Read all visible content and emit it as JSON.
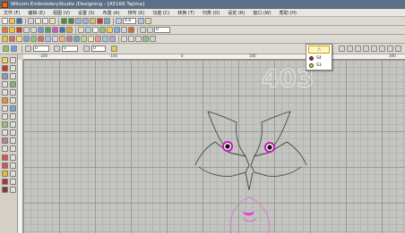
{
  "window": {
    "title": "Wilcom EmbroideryStudio /Designing - [A5166        Tajima]"
  },
  "menu": {
    "items": [
      "文件 (F)",
      "编辑 (E)",
      "视图 (V)",
      "设置 (S)",
      "布置 (A)",
      "排布 (K)",
      "功能 (C)",
      "转换 (T)",
      "归类 (O)",
      "设定 (R)",
      "窗口 (W)",
      "帮助 (H)"
    ]
  },
  "toolbar": {
    "zoom_value": "4.8",
    "combo_a": "0",
    "combo_b": "0",
    "combo_c": "0",
    "combo_d": "0"
  },
  "ruler": {
    "marks": [
      "-200",
      "-100",
      "0",
      "100",
      "200",
      "300"
    ]
  },
  "canvas": {
    "watermark": "403"
  },
  "thread_dropdown": {
    "options": [
      {
        "label": "S4",
        "color": "#d10f3a"
      },
      {
        "label": "S3",
        "color": "#e8d21a"
      }
    ]
  },
  "colors": {
    "outline": "#3b3b3b",
    "pink": "#e040d8",
    "eye_ring": "#c21ab8"
  }
}
